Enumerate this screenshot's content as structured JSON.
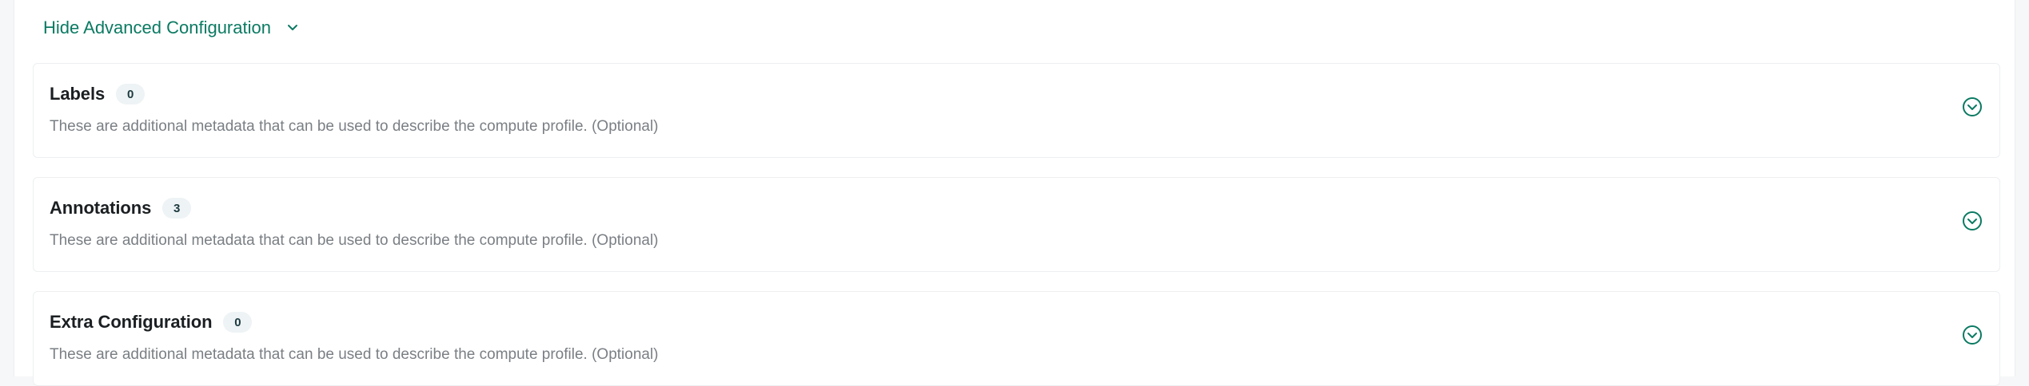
{
  "advanced_toggle": {
    "label": "Hide Advanced Configuration",
    "icon": "chevron-down-icon"
  },
  "sections": [
    {
      "title": "Labels",
      "count": "0",
      "description": "These are additional metadata that can be used to describe the compute profile. (Optional)",
      "icon": "chevron-circle-down-icon"
    },
    {
      "title": "Annotations",
      "count": "3",
      "description": "These are additional metadata that can be used to describe the compute profile. (Optional)",
      "icon": "chevron-circle-down-icon"
    },
    {
      "title": "Extra Configuration",
      "count": "0",
      "description": "These are additional metadata that can be used to describe the compute profile. (Optional)",
      "icon": "chevron-circle-down-icon"
    }
  ],
  "colors": {
    "accent": "#0b7a62",
    "title": "#1b1f22",
    "description": "#7a7f84",
    "badge_bg": "#eef3f5",
    "border": "#eceff1"
  }
}
